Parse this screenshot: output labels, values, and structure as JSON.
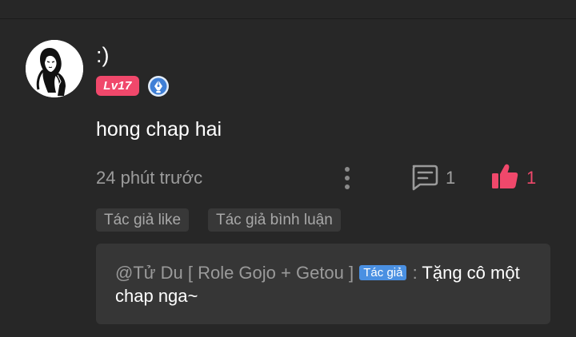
{
  "comment": {
    "username": ":)",
    "level": "Lv17",
    "text": "hong chap hai",
    "time": "24 phút trước",
    "reply_count": "1",
    "like_count": "1"
  },
  "chips": {
    "author_like": "Tác giả like",
    "author_reply": "Tác giả bình luận"
  },
  "reply": {
    "mention": "@Tử Du [ Role Gojo + Getou ]",
    "author_tag": "Tác giả",
    "separator": " : ",
    "text": "Tặng cô một chap nga~"
  },
  "icons": {
    "avatar": "avatar-drawing",
    "pen_badge": "pen-nib-icon",
    "more": "more-vertical-icon",
    "reply": "comment-icon",
    "like": "thumbs-up-icon"
  },
  "colors": {
    "background": "#272727",
    "accent": "#f0486b",
    "author_tag": "#4a90e2",
    "reply_box": "#363636",
    "chip": "#383838"
  }
}
